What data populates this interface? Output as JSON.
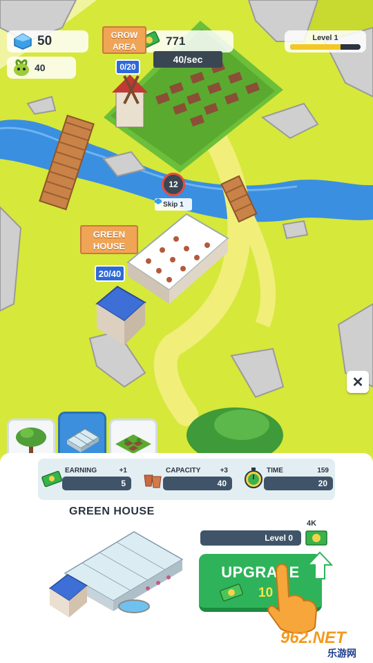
{
  "hud": {
    "gems": "50",
    "seeds": "40",
    "cash": "771",
    "cash_rate": "40/sec",
    "level_label": "Level 1",
    "level_progress": 0.72
  },
  "map": {
    "grow_area_sign": "GROW AREA",
    "grow_area_capacity": "0/20",
    "greenhouse_sign": "GREEN HOUSE",
    "greenhouse_capacity": "20/40",
    "build_timer": "12",
    "skip_label": "Skip",
    "skip_cost": "1"
  },
  "tabs": [
    {
      "icon": "tree-icon",
      "active": false
    },
    {
      "icon": "greenhouse-icon",
      "active": true
    },
    {
      "icon": "grow-plots-icon",
      "active": false
    }
  ],
  "panel": {
    "stats": [
      {
        "name": "EARNING",
        "delta": "+1",
        "value": "5",
        "icon": "cash-icon"
      },
      {
        "name": "CAPACITY",
        "delta": "+3",
        "value": "40",
        "icon": "pots-icon"
      },
      {
        "name": "TIME",
        "delta": "159",
        "value": "20",
        "icon": "stopwatch-icon"
      }
    ],
    "title": "GREEN HOUSE",
    "level_text": "Level 0",
    "next_cost": "4K",
    "upgrade_label": "UPGRADE",
    "upgrade_price": "10"
  },
  "watermark": {
    "brand": "962.NET",
    "sub": "乐游网"
  },
  "colors": {
    "grass": "#d9ea3a",
    "river": "#3a8fe0",
    "accent_blue": "#2d6ad8",
    "upgrade_green": "#2eb35a",
    "bar_dark": "#3f5468",
    "level_fill": "#f3c826"
  }
}
